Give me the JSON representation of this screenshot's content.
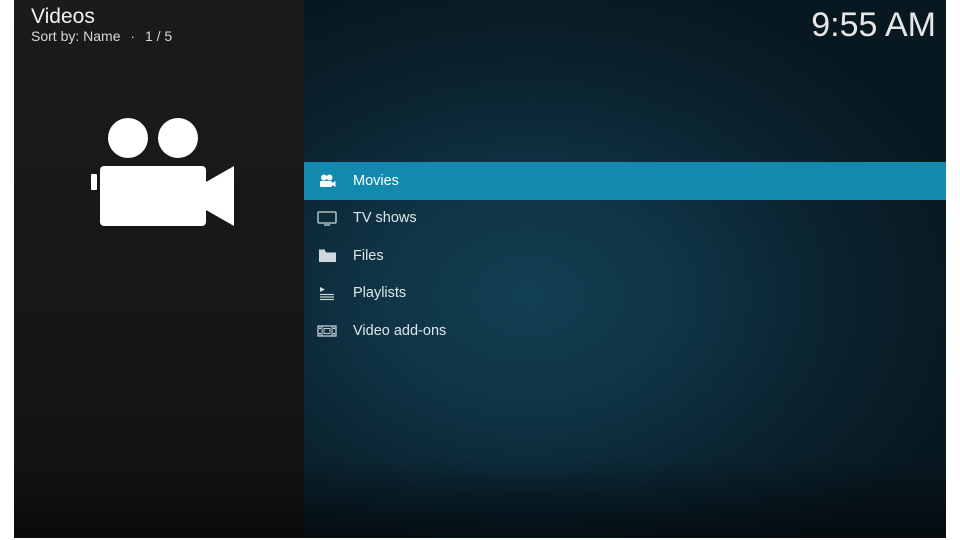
{
  "header": {
    "title": "Videos",
    "sort_label": "Sort by: Name",
    "separator": "·",
    "position": "1 / 5"
  },
  "clock": "9:55 AM",
  "main_icon": "video-camera-icon",
  "menu": {
    "selected_index": 0,
    "items": [
      {
        "label": "Movies",
        "icon": "movie-people-icon"
      },
      {
        "label": "TV shows",
        "icon": "tv-icon"
      },
      {
        "label": "Files",
        "icon": "folder-icon"
      },
      {
        "label": "Playlists",
        "icon": "playlist-icon"
      },
      {
        "label": "Video add-ons",
        "icon": "film-strip-icon"
      }
    ]
  },
  "colors": {
    "accent": "#1289ad",
    "left_panel": "#1b1b1b",
    "right_panel": "#0f3445",
    "text": "#dfe6ea"
  }
}
